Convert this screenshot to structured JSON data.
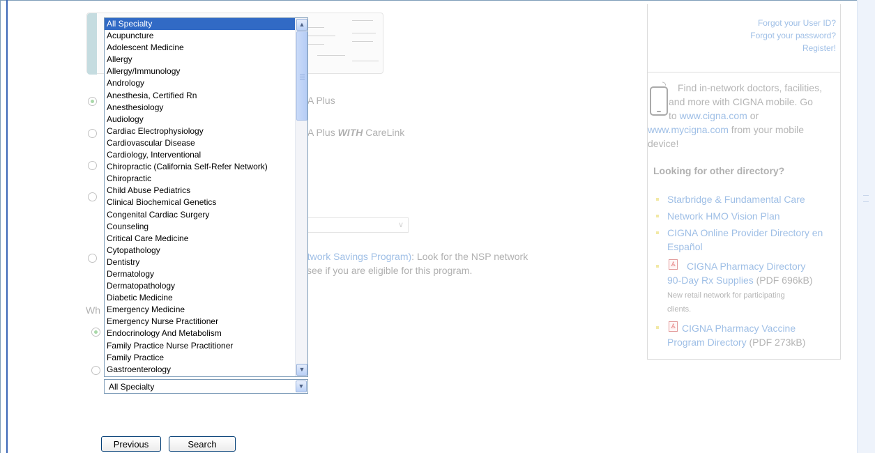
{
  "login_links": {
    "forgot_user_id": "Forgot your User ID?",
    "forgot_password": "Forgot your password?",
    "register": "Register!"
  },
  "mobile_promo": {
    "line1": "Find in-network doctors, facilities,",
    "line2": "and more with CIGNA mobile. Go",
    "line3_prefix": "to ",
    "line3_link": "www.cigna.com",
    "line3_suffix": " or",
    "line4_link": "www.mycigna.com",
    "line4_suffix": " from your mobile",
    "line5": "device!"
  },
  "other_directory": {
    "heading": "Looking for other directory?",
    "links": [
      "Starbridge & Fundamental Care",
      "Network HMO Vision Plan",
      "CIGNA Online Provider Directory en",
      "Español"
    ],
    "pharmacy_directory": {
      "line1": "CIGNA Pharmacy Directory",
      "line2": "90-Day Rx Supplies",
      "size": " (PDF 696kB)",
      "note1": "New retail network for participating",
      "note2": "clients."
    },
    "vaccine_directory": {
      "line1": "CIGNA Pharmacy Vaccine",
      "line2": "Program Directory",
      "size": " (PDF 273kB)"
    }
  },
  "plan_options": {
    "option1_text": "A Plus",
    "option2_text_prefix": "A Plus ",
    "option2_text_em": "WITH",
    "option2_text_suffix": " CareLink",
    "nsp_link": "etwork Savings Program)",
    "nsp_text": ": Look for the NSP network",
    "nsp_text2": "see if you are eligible for this program.",
    "question_prefix": "Wh"
  },
  "specialty_select": {
    "selected": "All Specialty",
    "options": [
      "All Specialty",
      "Acupuncture",
      "Adolescent Medicine",
      "Allergy",
      "Allergy/Immunology",
      "Andrology",
      "Anesthesia, Certified Rn",
      "Anesthesiology",
      "Audiology",
      "Cardiac Electrophysiology",
      "Cardiovascular Disease",
      "Cardiology, Interventional",
      "Chiropractic (California Self-Refer Network)",
      "Chiropractic",
      "Child Abuse Pediatrics",
      "Clinical Biochemical Genetics",
      "Congenital Cardiac Surgery",
      "Counseling",
      "Critical Care Medicine",
      "Cytopathology",
      "Dentistry",
      "Dermatology",
      "Dermatopathology",
      "Diabetic Medicine",
      "Emergency Medicine",
      "Emergency Nurse Practitioner",
      "Endocrinology And Metabolism",
      "Family Practice Nurse Practitioner",
      "Family Practice",
      "Gastroenterology"
    ]
  },
  "buttons": {
    "previous": "Previous",
    "search": "Search"
  },
  "icons": {
    "scroll_up": "▲",
    "scroll_down": "▼",
    "pdf": "pdf-icon",
    "phone": "phone-icon"
  }
}
